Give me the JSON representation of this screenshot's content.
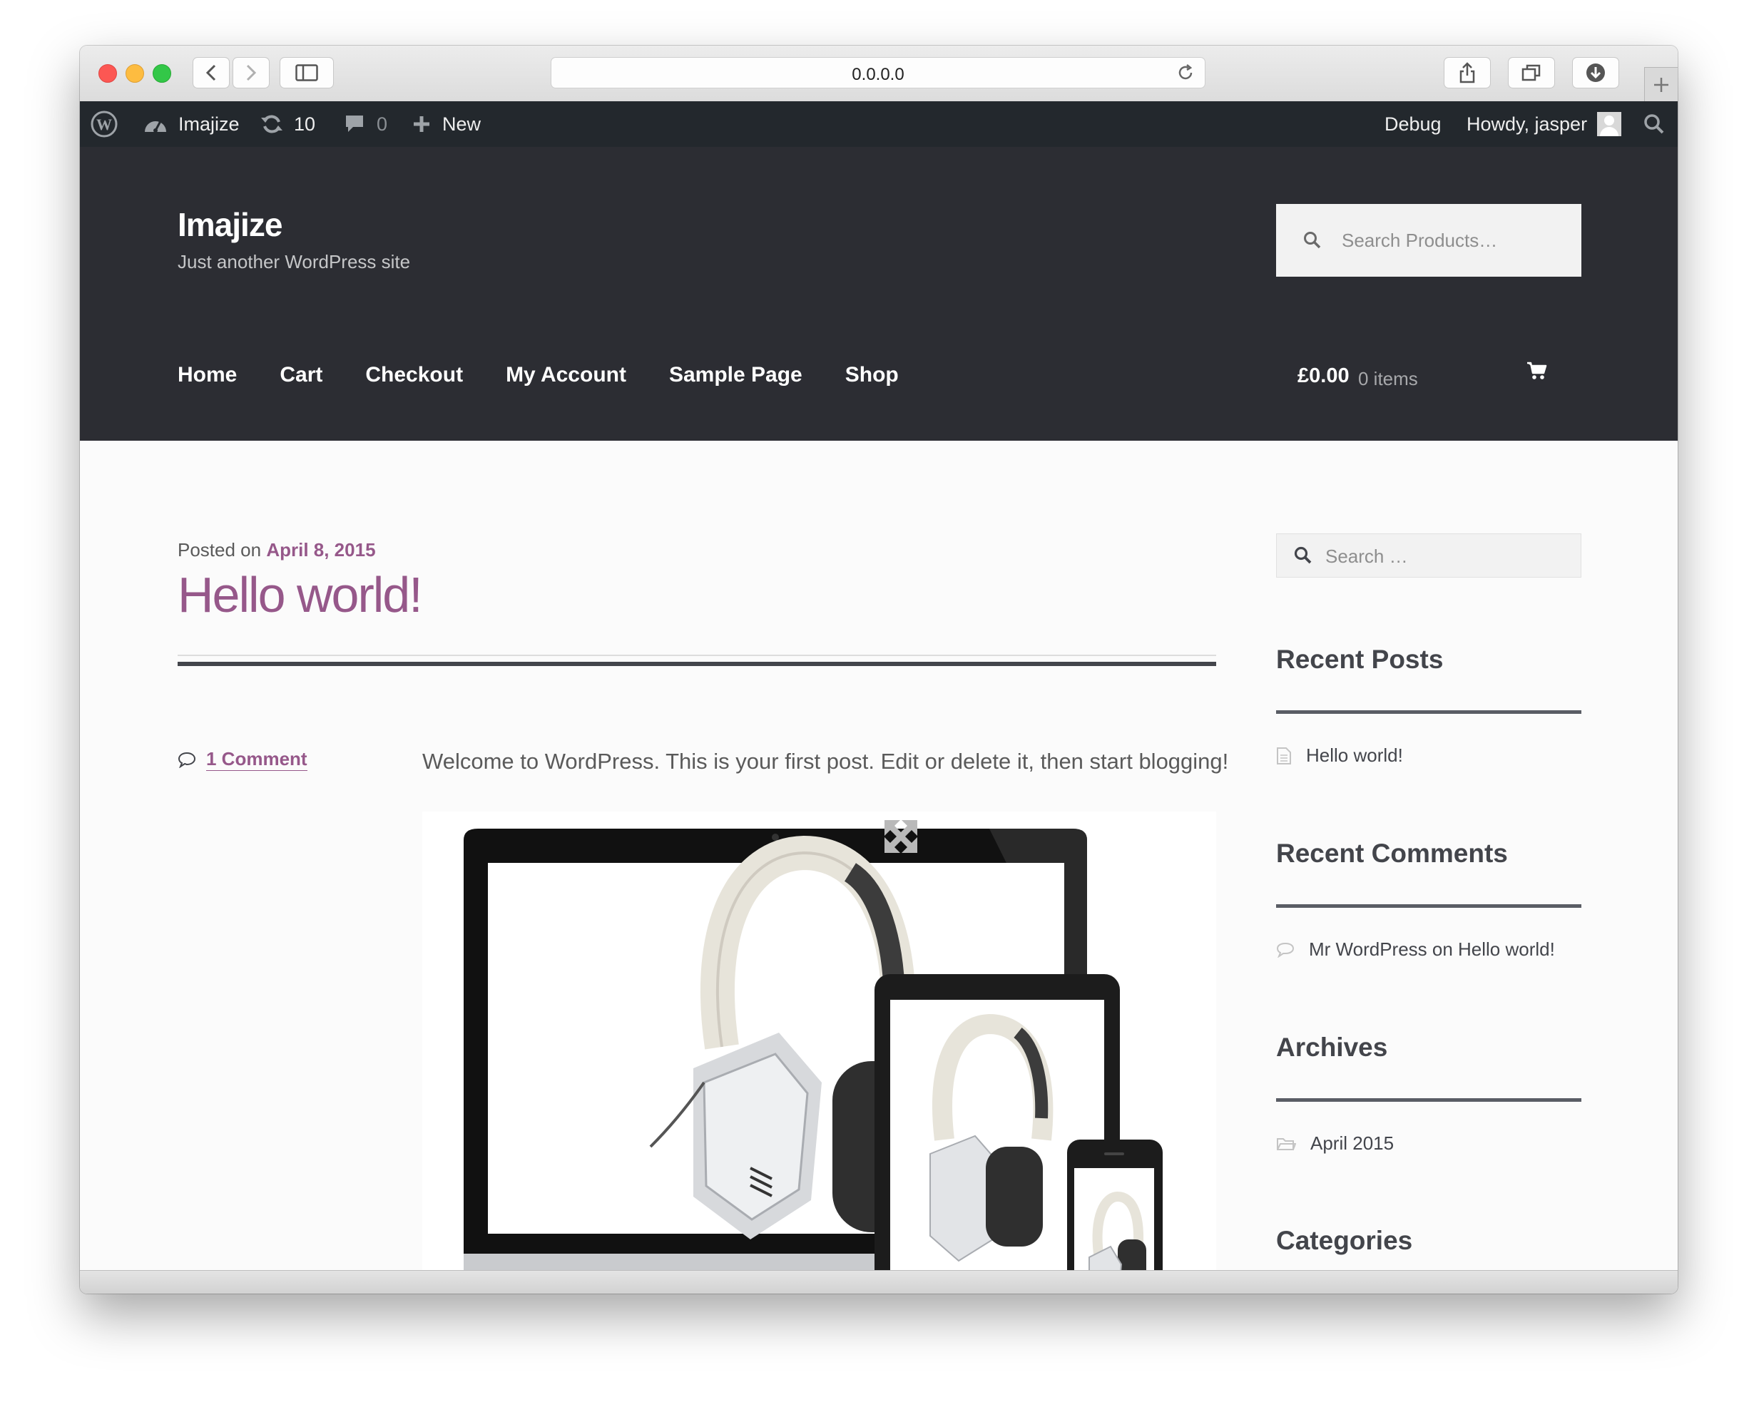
{
  "browser": {
    "url": "0.0.0.0"
  },
  "admin_bar": {
    "site_name": "Imajize",
    "updates_count": "10",
    "comments_count": "0",
    "new_label": "New",
    "debug_label": "Debug",
    "howdy": "Howdy, jasper"
  },
  "header": {
    "site_title": "Imajize",
    "site_description": "Just another WordPress site",
    "product_search_placeholder": "Search Products…",
    "nav": [
      "Home",
      "Cart",
      "Checkout",
      "My Account",
      "Sample Page",
      "Shop"
    ],
    "cart_total": "£0.00",
    "cart_count": "0 items"
  },
  "post": {
    "posted_prefix": "Posted on",
    "date": "April 8, 2015",
    "title": "Hello world!",
    "comments_link": "1 Comment",
    "body": "Welcome to WordPress. This is your first post. Edit or delete it, then start blogging!"
  },
  "sidebar": {
    "search_placeholder": "Search …",
    "recent_posts_title": "Recent Posts",
    "recent_posts": [
      "Hello world!"
    ],
    "recent_comments_title": "Recent Comments",
    "recent_comment": "Mr WordPress on Hello world!",
    "archives_title": "Archives",
    "archives": [
      "April 2015"
    ],
    "categories_title": "Categories"
  },
  "colors": {
    "accent": "#96588a",
    "header_bg": "#2c2d33",
    "admin_bar_bg": "#23282d"
  }
}
